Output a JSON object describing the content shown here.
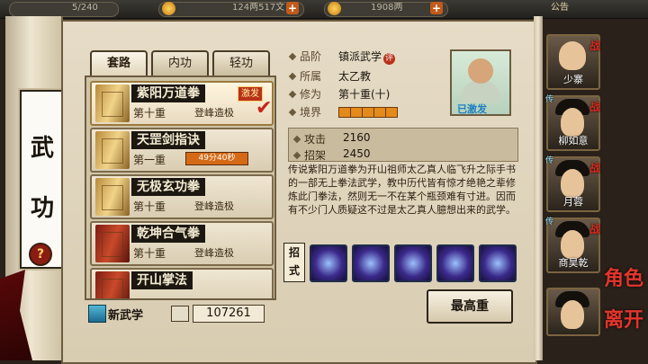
{
  "topbar": {
    "left_counter": "5/240",
    "silver": "124两517文",
    "gold": "1908两",
    "announce": "公告"
  },
  "side": {
    "title_chars": [
      "武",
      "功"
    ],
    "help": "?"
  },
  "tabs": [
    {
      "label": "套路",
      "active": true
    },
    {
      "label": "内功",
      "active": false
    },
    {
      "label": "轻功",
      "active": false
    }
  ],
  "skills": [
    {
      "name": "紫阳万道拳",
      "level": "第十重",
      "state": "登峰造极",
      "tag": "激发",
      "selected": true,
      "book": "gold"
    },
    {
      "name": "天罡剑指诀",
      "level": "第一重",
      "state": "",
      "timer": "49分40秒",
      "book": "gold"
    },
    {
      "name": "无极玄功拳",
      "level": "第十重",
      "state": "登峰造极",
      "book": "gold"
    },
    {
      "name": "乾坤合气拳",
      "level": "第十重",
      "state": "登峰造极",
      "book": "red"
    },
    {
      "name": "开山掌法",
      "level": "",
      "state": "",
      "book": "red"
    }
  ],
  "bottom_left": {
    "new_skill": "新武学",
    "amount": "107261"
  },
  "detail": {
    "rank_key": "品阶",
    "rank_val": "镇派武学",
    "rank_pin": "评",
    "school_key": "所属",
    "school_val": "太乙教",
    "cult_key": "修为",
    "cult_val": "第十重(十)",
    "realm_key": "境界",
    "realm_segments": 5,
    "activated": "已激发",
    "attack_key": "攻击",
    "attack_val": "2160",
    "parry_key": "招架",
    "parry_val": "2450",
    "description": "传说紫阳万道拳为开山祖师太乙真人临飞升之际手书的一部无上拳法武学，教中历代皆有惊才绝艳之辈修炼此门拳法，然则无一不在某个瓶颈难有寸进。因而有不少门人质疑这不过是太乙真人臆想出来的武学。",
    "moves_label": "招式",
    "move_icons": [
      "move-icon-1",
      "move-icon-2",
      "move-icon-3",
      "move-icon-4",
      "move-icon-5",
      "move-icon-6"
    ],
    "max_button": "最高重"
  },
  "party": [
    {
      "name": "少寨",
      "battle": "战",
      "pass": "传"
    },
    {
      "name": "柳如意",
      "battle": "战",
      "pass": "传"
    },
    {
      "name": "月蓉",
      "battle": "战",
      "pass": "传"
    },
    {
      "name": "商昊乾",
      "battle": "战",
      "pass": "传"
    },
    {
      "name": "",
      "battle": "",
      "pass": ""
    }
  ],
  "brand": {
    "line1": "角色",
    "line2": "离开"
  }
}
